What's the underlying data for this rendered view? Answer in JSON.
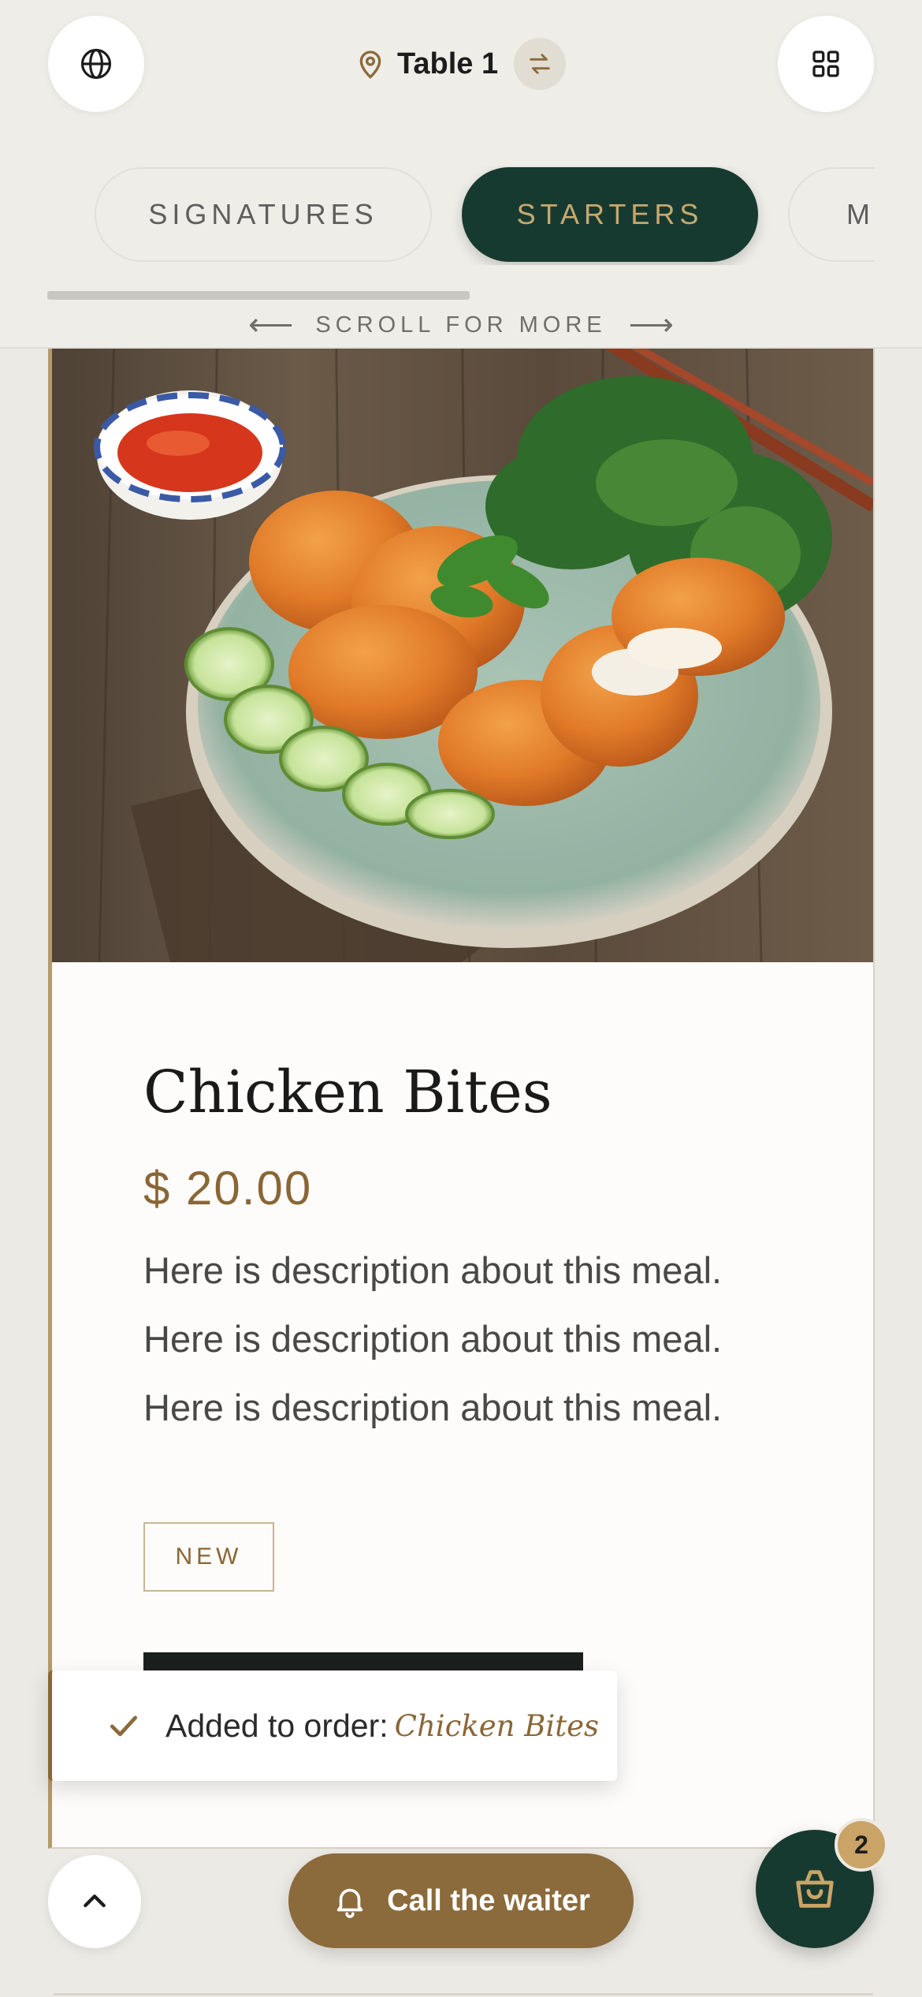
{
  "header": {
    "table_label": "Table 1",
    "icons": {
      "language": "globe-icon",
      "location": "map-pin-icon",
      "switch_table": "swap-icon",
      "grid": "grid-icon"
    }
  },
  "categories": {
    "tabs": [
      {
        "label": "SIGNATURES",
        "active": false
      },
      {
        "label": "STARTERS",
        "active": true
      },
      {
        "label": "M",
        "active": false
      }
    ],
    "scroll_hint": "SCROLL FOR MORE",
    "scroll_left_arrow": "⟵",
    "scroll_right_arrow": "⟶"
  },
  "dish": {
    "name": "Chicken Bites",
    "price": "$ 20.00",
    "description": [
      "Here is description about this meal.",
      "Here is description about this meal.",
      "Here is description about this meal."
    ],
    "badge": "NEW"
  },
  "toast": {
    "prefix": "Added to order:",
    "item": "Chicken Bites",
    "icon": "check-icon"
  },
  "bottom_bar": {
    "call_waiter_label": "Call the waiter",
    "cart_count": "2",
    "icons": {
      "scroll_top": "chevron-up-icon",
      "bell": "bell-icon",
      "cart": "shopping-bag-icon"
    }
  },
  "colors": {
    "brand_green": "#173a30",
    "accent_gold": "#8b6a3b",
    "price_color": "#8a6636",
    "background": "#eceae5"
  }
}
